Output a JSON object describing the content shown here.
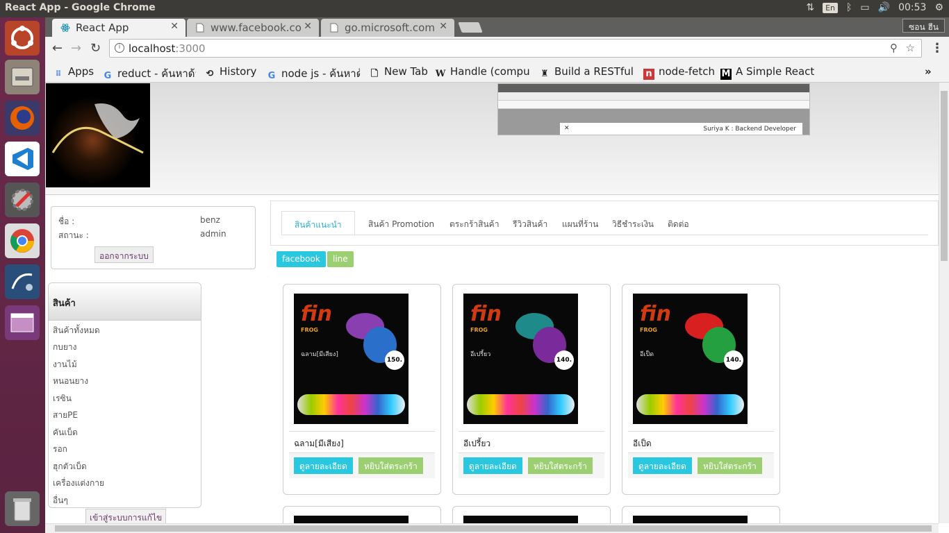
{
  "os": {
    "window_title": "React App - Google Chrome",
    "lang": "En",
    "time": "00:53"
  },
  "browser": {
    "tabs": [
      {
        "label": "React App"
      },
      {
        "label": "www.facebook.co"
      },
      {
        "label": "go.microsoft.com"
      }
    ],
    "user_button": "ซอน ฮีน",
    "url_host": "localhost",
    "url_port": ":3000",
    "bookmarks": [
      {
        "label": "Apps"
      },
      {
        "label": "reduct - ค้นหาด้วย"
      },
      {
        "label": "History"
      },
      {
        "label": "node js - ค้นหาด้วย"
      },
      {
        "label": "New Tab"
      },
      {
        "label": "Handle (comput"
      },
      {
        "label": "Build a RESTful A"
      },
      {
        "label": "node-fetch"
      },
      {
        "label": "A Simple React R"
      }
    ]
  },
  "page": {
    "thumbnail_toast": "Suriya K : Backend Developer",
    "user": {
      "name_label": "ชื่อ :",
      "name_value": "benz",
      "status_label": "สถานะ :",
      "status_value": "admin",
      "logout": "ออกจากระบบ"
    },
    "nav_tabs": [
      "สินค้าแนะนำ",
      "สินค้า Promotion",
      "ตระกร้าสินค้า",
      "รีวิวสินค้า",
      "แผนที่ร้าน",
      "วิธีชำระเงิน",
      "ติดต่อ"
    ],
    "social": {
      "facebook": "facebook",
      "line": "line"
    },
    "sidebar": {
      "title": "สินค้า",
      "items": [
        "สินค้าทั้งหมด",
        "กบยาง",
        "งานไม้",
        "หนอนยาง",
        "เรซิน",
        "สายPE",
        "คันเบ็ด",
        "รอก",
        "ฮุกตัวเบ็ด",
        "เครื่องแต่งกาย",
        "อื่นๆ"
      ],
      "admin_button": "เข้าสู่ระบบการแก้ไข"
    },
    "products": [
      {
        "name": "ฉลาม[มีเสียง]",
        "price_badge": "150.",
        "details": "ดูลายละเอียด",
        "add": "หยิบใส่ตระกร้า",
        "color1": "#8a3fb0",
        "color2": "#2a6fc9"
      },
      {
        "name": "อีเปรี้ยว",
        "price_badge": "140.",
        "details": "ดูลายละเอียด",
        "add": "หยิบใส่ตระกร้า",
        "color1": "#1f8a8a",
        "color2": "#7a2a9a"
      },
      {
        "name": "อีเป็ด",
        "price_badge": "140.",
        "details": "ดูลายละเอียด",
        "add": "หยิบใส่ตระกร้า",
        "color1": "#d82020",
        "color2": "#25a040"
      }
    ]
  }
}
